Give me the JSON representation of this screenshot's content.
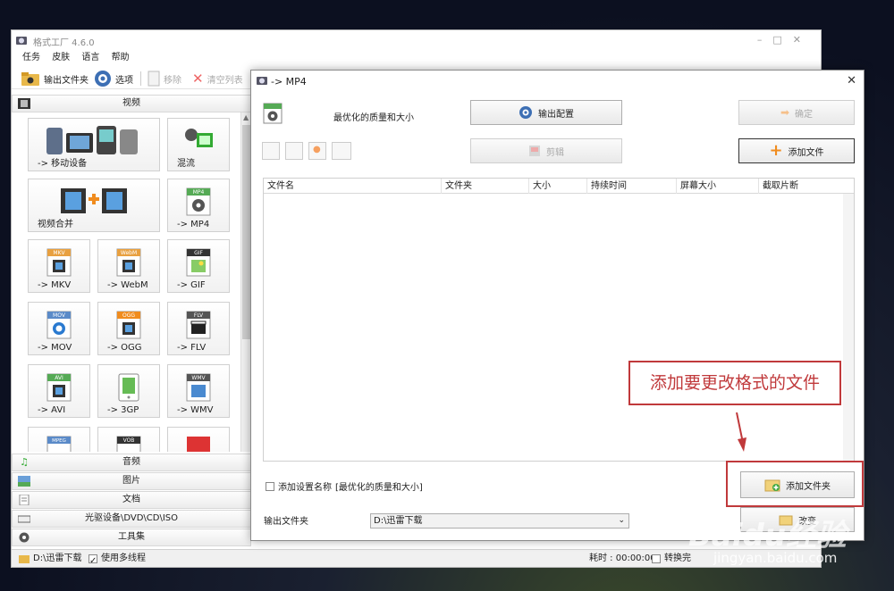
{
  "main": {
    "title": "格式工厂 4.6.0",
    "menu": [
      "任务",
      "皮肤",
      "语言",
      "帮助"
    ],
    "toolbar": {
      "output_folder": "输出文件夹",
      "options": "选项",
      "remove": "移除",
      "clear_list": "清空列表"
    },
    "categories": {
      "video": "视频",
      "audio": "音频",
      "picture": "图片",
      "document": "文档",
      "optical": "光驱设备\\DVD\\CD\\ISO",
      "tools": "工具集"
    },
    "tiles": {
      "mobile": "-> 移动设备",
      "mix": "混流",
      "merge": "视频合并",
      "mp4": "-> MP4",
      "mkv": "-> MKV",
      "webm": "-> WebM",
      "gif": "-> GIF",
      "mov": "-> MOV",
      "ogg": "-> OGG",
      "flv": "-> FLV",
      "avi": "-> AVI",
      "gp3": "-> 3GP",
      "wmv": "-> WMV"
    },
    "tile_badges": {
      "mp4": "MP4",
      "mkv": "MKV",
      "webm": "WebM",
      "gif": "GIF",
      "mov": "MOV",
      "ogg": "OGG",
      "flv": "FLV",
      "avi": "AVI",
      "wmv": "WMV",
      "mpeg": "MPEG",
      "vob": "VOB"
    },
    "status": {
      "path": "D:\\迅雷下载",
      "multithread": "使用多线程",
      "elapsed": "耗时 : 00:00:00",
      "after": "转换完"
    }
  },
  "dialog": {
    "title": "-> MP4",
    "preset": "最优化的质量和大小",
    "output_config": "输出配置",
    "ok": "确定",
    "clip": "剪辑",
    "add_file": "添加文件",
    "columns": [
      "文件名",
      "文件夹",
      "大小",
      "持续时间",
      "屏幕大小",
      "截取片断"
    ],
    "callout": "添加要更改格式的文件",
    "add_folder": "添加文件夹",
    "add_preset_name": "添加设置名称",
    "preset_bracket": "[最优化的质量和大小]",
    "output_folder_label": "输出文件夹",
    "output_folder_value": "D:\\迅雷下载",
    "change": "改变"
  },
  "watermark": {
    "logo": "Baidu经验",
    "site": "jingyan.baidu.com"
  },
  "colors": {
    "accent_red": "#c0393b",
    "orange": "#f08c1e"
  }
}
